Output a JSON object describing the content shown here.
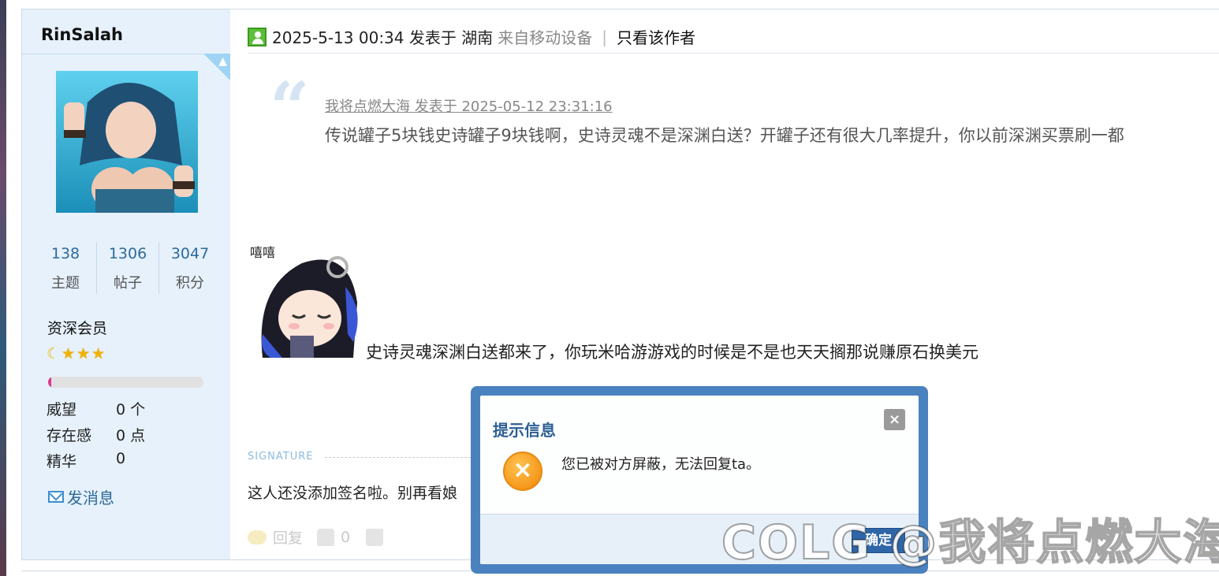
{
  "user": {
    "username": "RinSalah",
    "stats": [
      {
        "value": "138",
        "label": "主题"
      },
      {
        "value": "1306",
        "label": "帖子"
      },
      {
        "value": "3047",
        "label": "积分"
      }
    ],
    "rank": "资深会员",
    "rank_progress": 0.02,
    "info": [
      {
        "key": "威望",
        "value": "0 个"
      },
      {
        "key": "存在感",
        "value": "0 点"
      },
      {
        "key": "精华",
        "value": "0"
      }
    ],
    "message_link": "发消息"
  },
  "post": {
    "time": "2025-5-13 00:34 发表于 湖南",
    "device": "来自移动设备",
    "separator": "|",
    "only_author": "只看该作者",
    "quote": {
      "author_line": "我将点燃大海 发表于 2025-05-12 23:31:16",
      "text": "传说罐子5块钱史诗罐子9块钱啊，史诗灵魂不是深渊白送？开罐子还有很大几率提升，你以前深渊买票刷一都"
    },
    "sticker_text": "嘻嘻",
    "reply": "史诗灵魂深渊白送都来了，你玩米哈游游戏的时候是不是也天天搁那说赚原石换美元",
    "signature_label": "SIGNATURE",
    "signature": "这人还没添加签名啦。别再看娘"
  },
  "actions": {
    "reply": "回复",
    "likes": "0"
  },
  "dialog": {
    "title": "提示信息",
    "close": "×",
    "message": "您已被对方屏蔽，无法回复ta。",
    "ok": "确定"
  },
  "watermark": "COLG @我将点燃大海"
}
